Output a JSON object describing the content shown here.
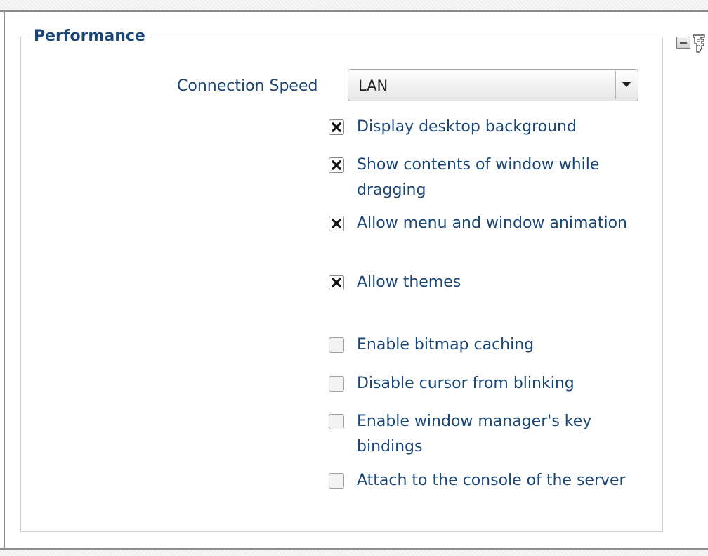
{
  "section": {
    "title": "Performance",
    "connection_speed": {
      "label": "Connection Speed",
      "value": "LAN"
    },
    "options": [
      {
        "label": "Display desktop background",
        "checked": true
      },
      {
        "label": "Show contents of window while dragging",
        "checked": true
      },
      {
        "label": "Allow menu and window animation",
        "checked": true
      },
      {
        "label": "Allow themes",
        "checked": true
      },
      {
        "label": "Enable bitmap caching",
        "checked": false
      },
      {
        "label": "Disable cursor from blinking",
        "checked": false
      },
      {
        "label": "Enable window manager's key bindings",
        "checked": false
      },
      {
        "label": "Attach to the console of the server",
        "checked": false
      }
    ]
  },
  "icons": {
    "collapse": "minus-icon",
    "pointer": "hand-pointer-icon",
    "checked_mark": "x-mark-icon",
    "dropdown": "chevron-down-icon"
  },
  "colors": {
    "label_text": "#1a4675",
    "border": "#8c8c8c"
  }
}
